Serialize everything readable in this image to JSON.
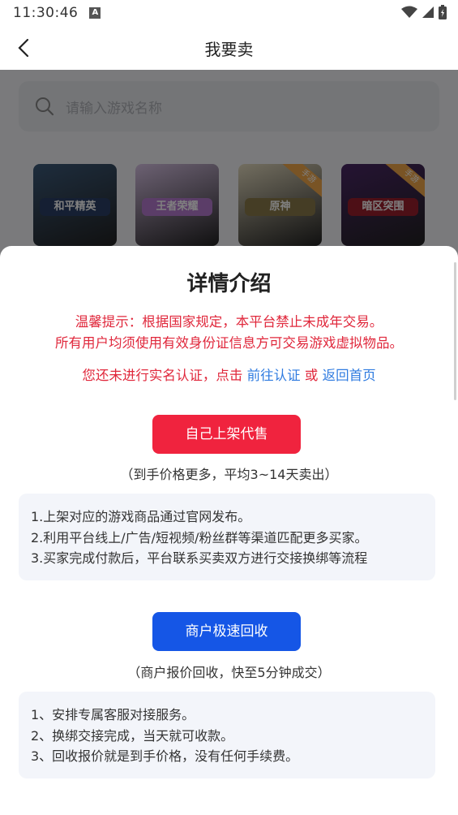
{
  "status_bar": {
    "time": "11:30:46",
    "notif_badge": "A"
  },
  "nav": {
    "title": "我要卖"
  },
  "search": {
    "placeholder": "请输入游戏名称"
  },
  "games": [
    {
      "label": "和平精英",
      "badge": "",
      "bg": "#3c5a7a",
      "label_bg": "#2a3f66"
    },
    {
      "label": "王者荣耀",
      "badge": "",
      "bg": "#d9c3e6",
      "label_bg": "#b77ad1"
    },
    {
      "label": "原神",
      "badge": "手游",
      "bg": "#e5dcc0",
      "label_bg": "#8a7a4a"
    },
    {
      "label": "暗区突围",
      "badge": "手游",
      "bg": "#4a2766",
      "label_bg": "#9b1f2c"
    }
  ],
  "sheet": {
    "title": "详情介绍",
    "notice_line1": "温馨提示：根据国家规定，本平台禁止未成年交易。",
    "notice_line2": "所有用户均须使用有效身份证信息方可交易游戏虚拟物品。",
    "verify_prefix": "您还未进行实名认证，点击 ",
    "verify_link": "前往认证",
    "verify_or": " 或 ",
    "home_link": "返回首页",
    "self_sell": {
      "button": "自己上架代售",
      "note": "（到手价格更多，平均3~14天卖出）",
      "items": [
        "1.上架对应的游戏商品通过官网发布。",
        "2.利用平台线上/广告/短视频/粉丝群等渠道匹配更多买家。",
        "3.买家完成付款后，平台联系买卖双方进行交接换绑等流程"
      ]
    },
    "merchant": {
      "button": "商户极速回收",
      "note": "（商户报价回收，快至5分钟成交）",
      "items": [
        "1、安排专属客服对接服务。",
        "2、换绑交接完成，当天就可收款。",
        "3、回收报价就是到手价格，没有任何手续费。"
      ]
    }
  },
  "colors": {
    "red": "#f0233e",
    "blue": "#1556e6",
    "notice": "#e0283c",
    "link": "#2f7be0"
  }
}
